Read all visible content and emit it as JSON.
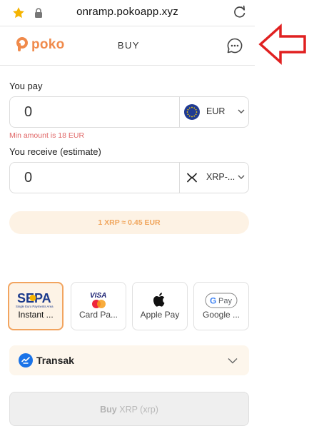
{
  "browser": {
    "url": "onramp.pokoapp.xyz",
    "star_icon": "star-icon",
    "lock_icon": "lock-icon",
    "reload_icon": "reload-icon"
  },
  "header": {
    "logo_text": "poko",
    "title": "BUY",
    "chat_icon": "chat-bubble-icon"
  },
  "pay": {
    "label": "You pay",
    "value": "0",
    "currency": "EUR",
    "currency_icon": "eu-flag-icon",
    "error": "Min amount is 18 EUR"
  },
  "receive": {
    "label": "You receive (estimate)",
    "value": "0",
    "currency": "XRP-...",
    "currency_icon": "xrp-icon"
  },
  "rate": "1 XRP ≈ 0.45 EUR",
  "methods": [
    {
      "label": "Instant ...",
      "icon": "sepa-logo",
      "selected": true
    },
    {
      "label": "Card Pa...",
      "icon": "visa-mastercard-logo",
      "selected": false
    },
    {
      "label": "Apple Pay",
      "icon": "apple-icon",
      "selected": false
    },
    {
      "label": "Google ...",
      "icon": "google-pay-logo",
      "selected": false
    }
  ],
  "sepa_logo_text": "SEPA",
  "sepa_logo_sub": "Single Euro Payments Area",
  "visa_text": "VISA",
  "gpay_text": "Pay",
  "provider": {
    "name": "Transak",
    "icon": "transak-icon"
  },
  "buy_button": {
    "label": "Buy",
    "sub": "XRP (xrp)"
  },
  "annotation": {
    "icon": "red-arrow-left-icon",
    "color": "#e02020"
  },
  "colors": {
    "brand": "#f08a4b",
    "rate_text": "#f0a55c",
    "error": "#e06666"
  }
}
